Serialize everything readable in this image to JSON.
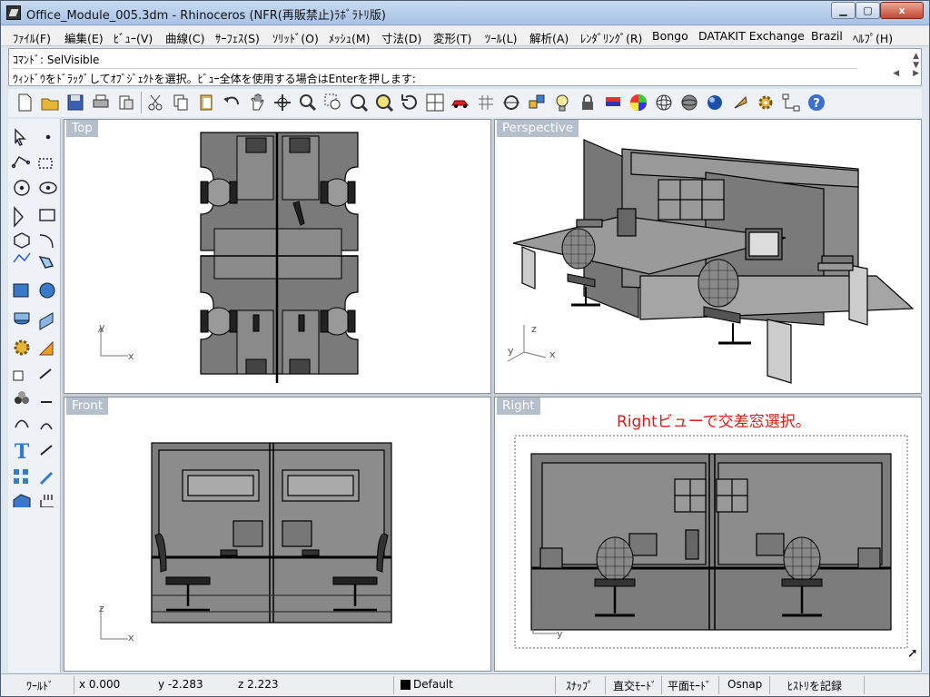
{
  "window": {
    "title": "Office_Module_005.3dm - Rhinoceros (NFR(再販禁止)ﾗﾎﾞﾗﾄﾘ版)",
    "close_label": "x"
  },
  "menu": [
    "ﾌｧｲﾙ(F)",
    "編集(E)",
    "ﾋﾞｭｰ(V)",
    "曲線(C)",
    "ｻｰﾌｪｽ(S)",
    "ｿﾘｯﾄﾞ(O)",
    "ﾒｯｼｭ(M)",
    "寸法(D)",
    "変形(T)",
    "ﾂｰﾙ(L)",
    "解析(A)",
    "ﾚﾝﾀﾞﾘﾝｸﾞ(R)",
    "Bongo",
    "DATAKIT Exchange",
    "Brazil",
    "ﾍﾙﾌﾟ(H)"
  ],
  "command": {
    "history": "ｺﾏﾝﾄﾞ: SelVisible",
    "prompt": "ｳｨﾝﾄﾞｳをﾄﾞﾗｯｸﾞしてｵﾌﾞｼﾞｪｸﾄを選択。ﾋﾞｭｰ全体を使用する場合はEnterを押します:"
  },
  "viewports": {
    "top": "Top",
    "perspective": "Perspective",
    "front": "Front",
    "right": "Right"
  },
  "annotation": "Rightビューで交差窓選択。",
  "axes": {
    "x": "x",
    "y": "y",
    "z": "z"
  },
  "status": {
    "cplane": "ﾜｰﾙﾄﾞ",
    "x": "x 0.000",
    "y": "y -2.283",
    "z": "z 2.223",
    "layer": "Default",
    "snap": "ｽﾅｯﾌﾟ",
    "ortho": "直交ﾓｰﾄﾞ",
    "planar": "平面ﾓｰﾄﾞ",
    "osnap": "Osnap",
    "history": "ﾋｽﾄﾘを記録"
  },
  "colors": {
    "annotation": "#e01818",
    "viewport_label": "#b5bfcc",
    "model_fill": "#7a7a7a"
  }
}
